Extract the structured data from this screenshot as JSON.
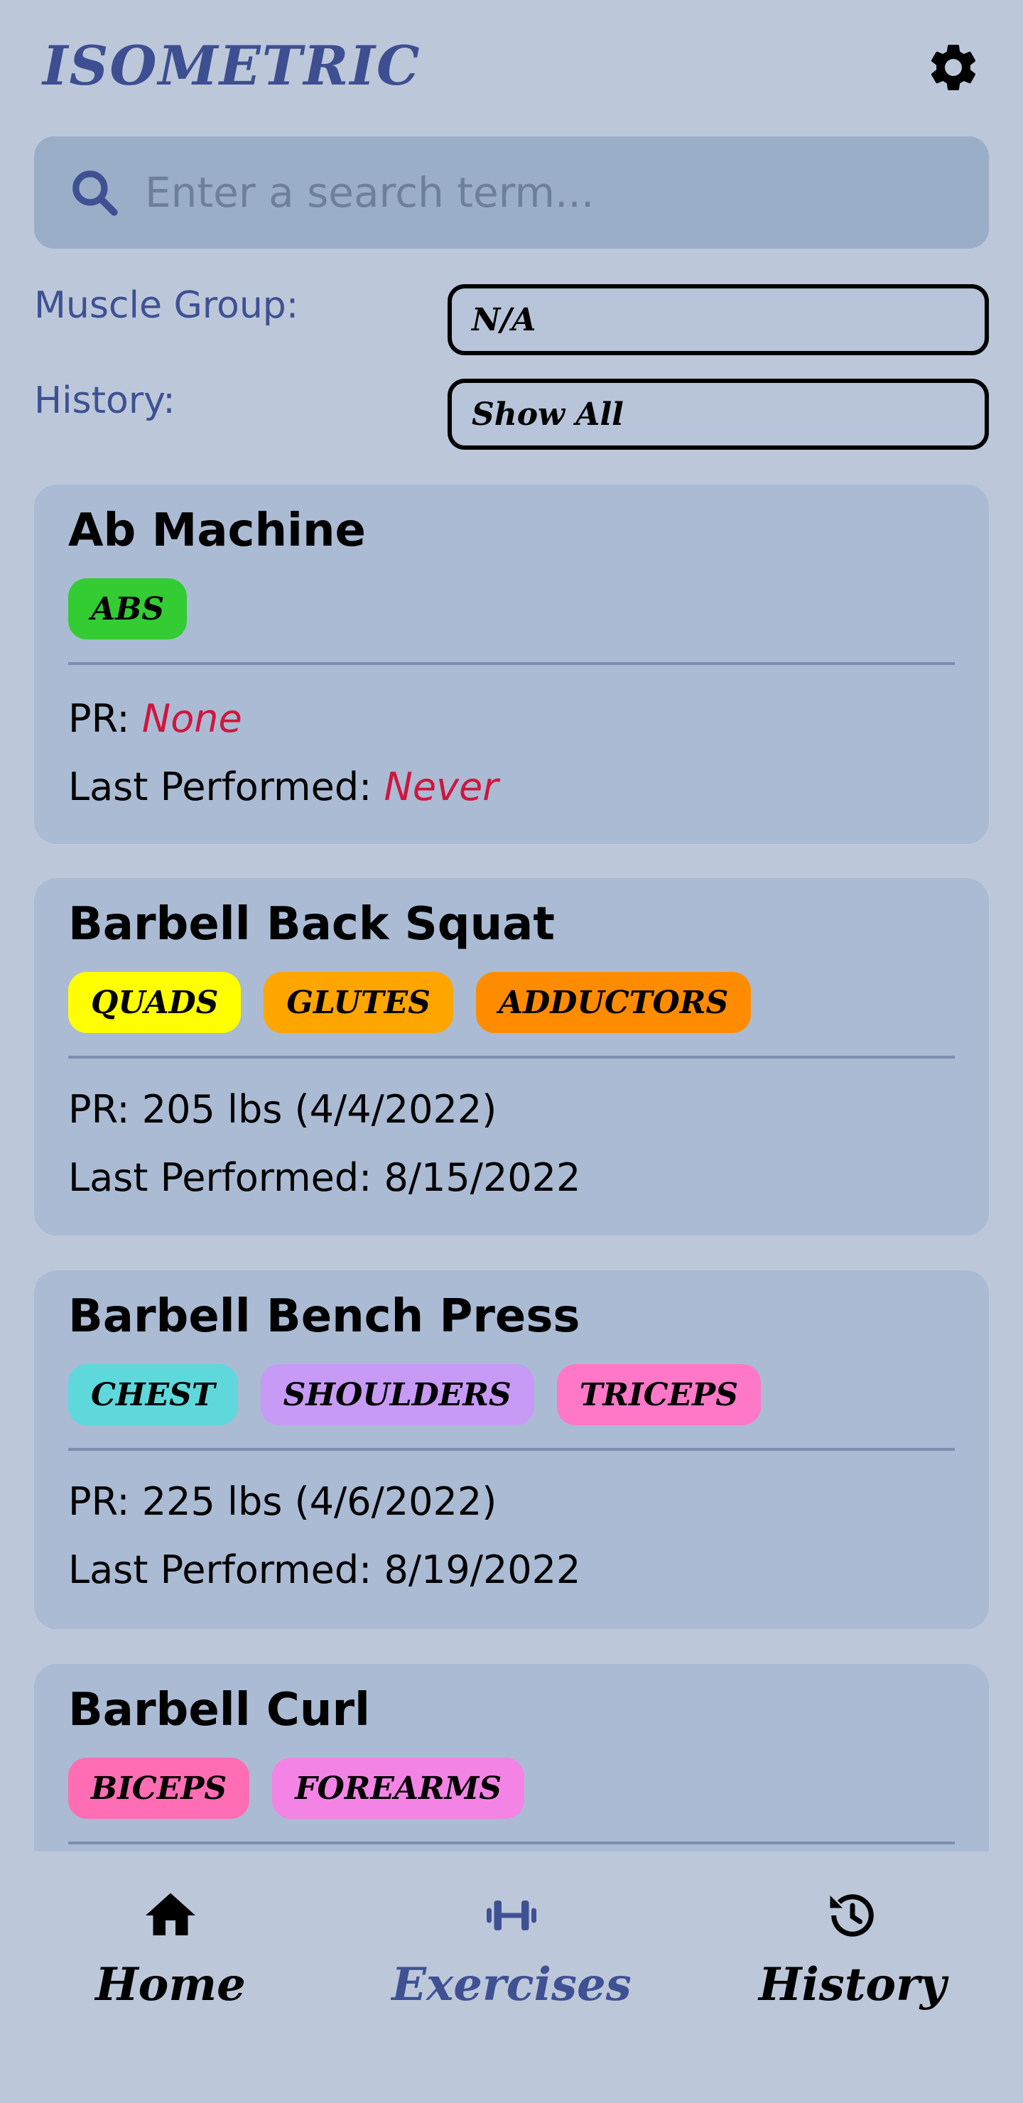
{
  "header": {
    "title": "Isometric"
  },
  "search": {
    "placeholder": "Enter a search term..."
  },
  "filters": {
    "muscle_group_label": "Muscle Group:",
    "muscle_group_value": "N/A",
    "history_label": "History:",
    "history_value": "Show All"
  },
  "cards": [
    {
      "title": "Ab Machine",
      "tags": [
        {
          "label": "Abs",
          "color": "#33cc33"
        }
      ],
      "pr_label": "PR:",
      "pr_value": "None",
      "last_label": "Last Performed:",
      "last_value": "Never"
    },
    {
      "title": "Barbell Back Squat",
      "tags": [
        {
          "label": "Quads",
          "color": "#ffff00"
        },
        {
          "label": "Glutes",
          "color": "#ffa500"
        },
        {
          "label": "Adductors",
          "color": "#ff8c00"
        }
      ],
      "pr_label": "PR:",
      "pr_value": "205 lbs (4/4/2022)",
      "last_label": "Last Performed:",
      "last_value": "8/15/2022"
    },
    {
      "title": "Barbell Bench Press",
      "tags": [
        {
          "label": "Chest",
          "color": "#5fd8dc"
        },
        {
          "label": "Shoulders",
          "color": "#c79af5"
        },
        {
          "label": "Triceps",
          "color": "#ff78c8"
        }
      ],
      "pr_label": "PR:",
      "pr_value": "225 lbs (4/6/2022)",
      "last_label": "Last Performed:",
      "last_value": "8/19/2022"
    },
    {
      "title": "Barbell Curl",
      "tags": [
        {
          "label": "Biceps",
          "color": "#ff6eb4"
        },
        {
          "label": "Forearms",
          "color": "#f384e5"
        }
      ]
    }
  ],
  "nav": {
    "home": "Home",
    "exercises": "Exercises",
    "history": "History",
    "active_color": "#3f5193"
  }
}
